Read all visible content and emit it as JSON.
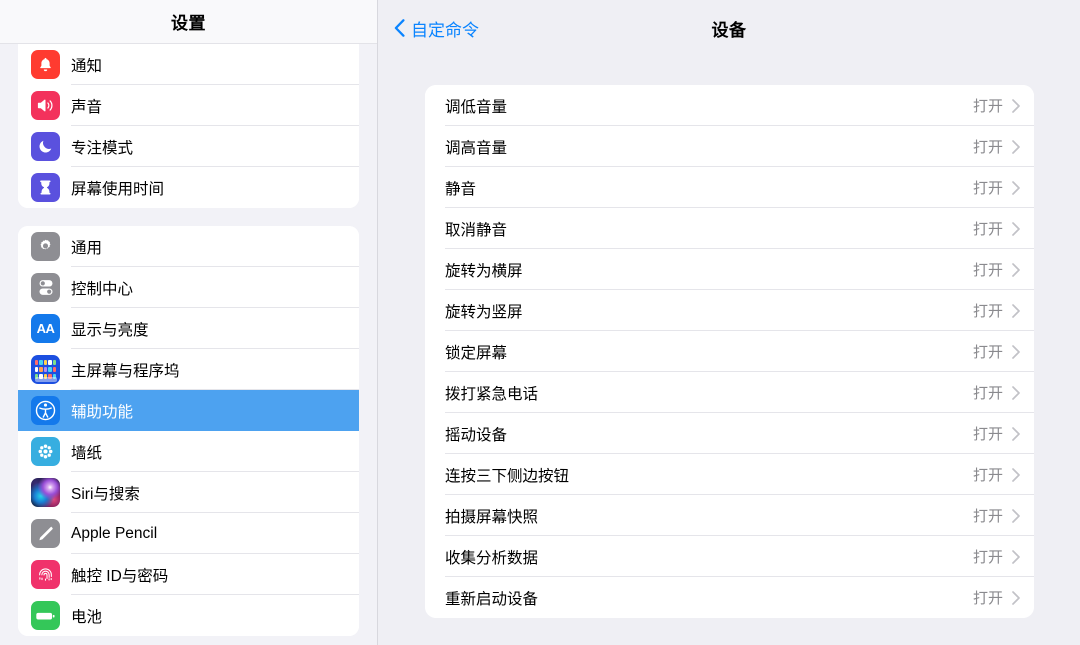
{
  "sidebar": {
    "header_title": "设置",
    "groups": [
      {
        "items": [
          {
            "label": "通知",
            "icon": "bell-icon",
            "tile_color": "#FF3B30",
            "selected": false
          },
          {
            "label": "声音",
            "icon": "speaker-icon",
            "tile_color": "#F3325C",
            "selected": false
          },
          {
            "label": "专注模式",
            "icon": "moon-icon",
            "tile_color": "#5A51DE",
            "selected": false
          },
          {
            "label": "屏幕使用时间",
            "icon": "hourglass-icon",
            "tile_color": "#5A51DE",
            "selected": false
          }
        ]
      },
      {
        "items": [
          {
            "label": "通用",
            "icon": "gear-icon",
            "tile_color": "#8E8E93",
            "selected": false
          },
          {
            "label": "控制中心",
            "icon": "toggles-icon",
            "tile_color": "#8E8E93",
            "selected": false
          },
          {
            "label": "显示与亮度",
            "icon": "text-size-icon",
            "tile_color": "#1479EB",
            "selected": false
          },
          {
            "label": "主屏幕与程序坞",
            "icon": "home-screen-icon",
            "tile_color": "#1C4FE0",
            "selected": false
          },
          {
            "label": "辅助功能",
            "icon": "accessibility-icon",
            "tile_color": "#1479EB",
            "selected": true
          },
          {
            "label": "墙纸",
            "icon": "wallpaper-icon",
            "tile_color": "#37AEE0",
            "selected": false
          },
          {
            "label": "Siri与搜索",
            "icon": "siri-icon",
            "tile_color": "#1a1030",
            "selected": false
          },
          {
            "label": "Apple Pencil",
            "icon": "pencil-icon",
            "tile_color": "#8E8E93",
            "selected": false
          },
          {
            "label": "触控 ID与密码",
            "icon": "fingerprint-icon",
            "tile_color": "#F0326B",
            "selected": false
          },
          {
            "label": "电池",
            "icon": "battery-icon",
            "tile_color": "#34C759",
            "selected": false
          }
        ]
      }
    ],
    "selected_highlight_color": "#4DA2F0"
  },
  "detail": {
    "back_label": "自定命令",
    "back_icon": "chevron-left-icon",
    "back_color": "#0A84FF",
    "title": "设备",
    "rows": [
      {
        "label": "调低音量",
        "value": "打开"
      },
      {
        "label": "调高音量",
        "value": "打开"
      },
      {
        "label": "静音",
        "value": "打开"
      },
      {
        "label": "取消静音",
        "value": "打开"
      },
      {
        "label": "旋转为横屏",
        "value": "打开"
      },
      {
        "label": "旋转为竖屏",
        "value": "打开"
      },
      {
        "label": "锁定屏幕",
        "value": "打开"
      },
      {
        "label": "拨打紧急电话",
        "value": "打开"
      },
      {
        "label": "摇动设备",
        "value": "打开"
      },
      {
        "label": "连按三下侧边按钮",
        "value": "打开"
      },
      {
        "label": "拍摄屏幕快照",
        "value": "打开"
      },
      {
        "label": "收集分析数据",
        "value": "打开"
      },
      {
        "label": "重新启动设备",
        "value": "打开"
      }
    ],
    "row_chevron_icon": "chevron-right-icon"
  }
}
